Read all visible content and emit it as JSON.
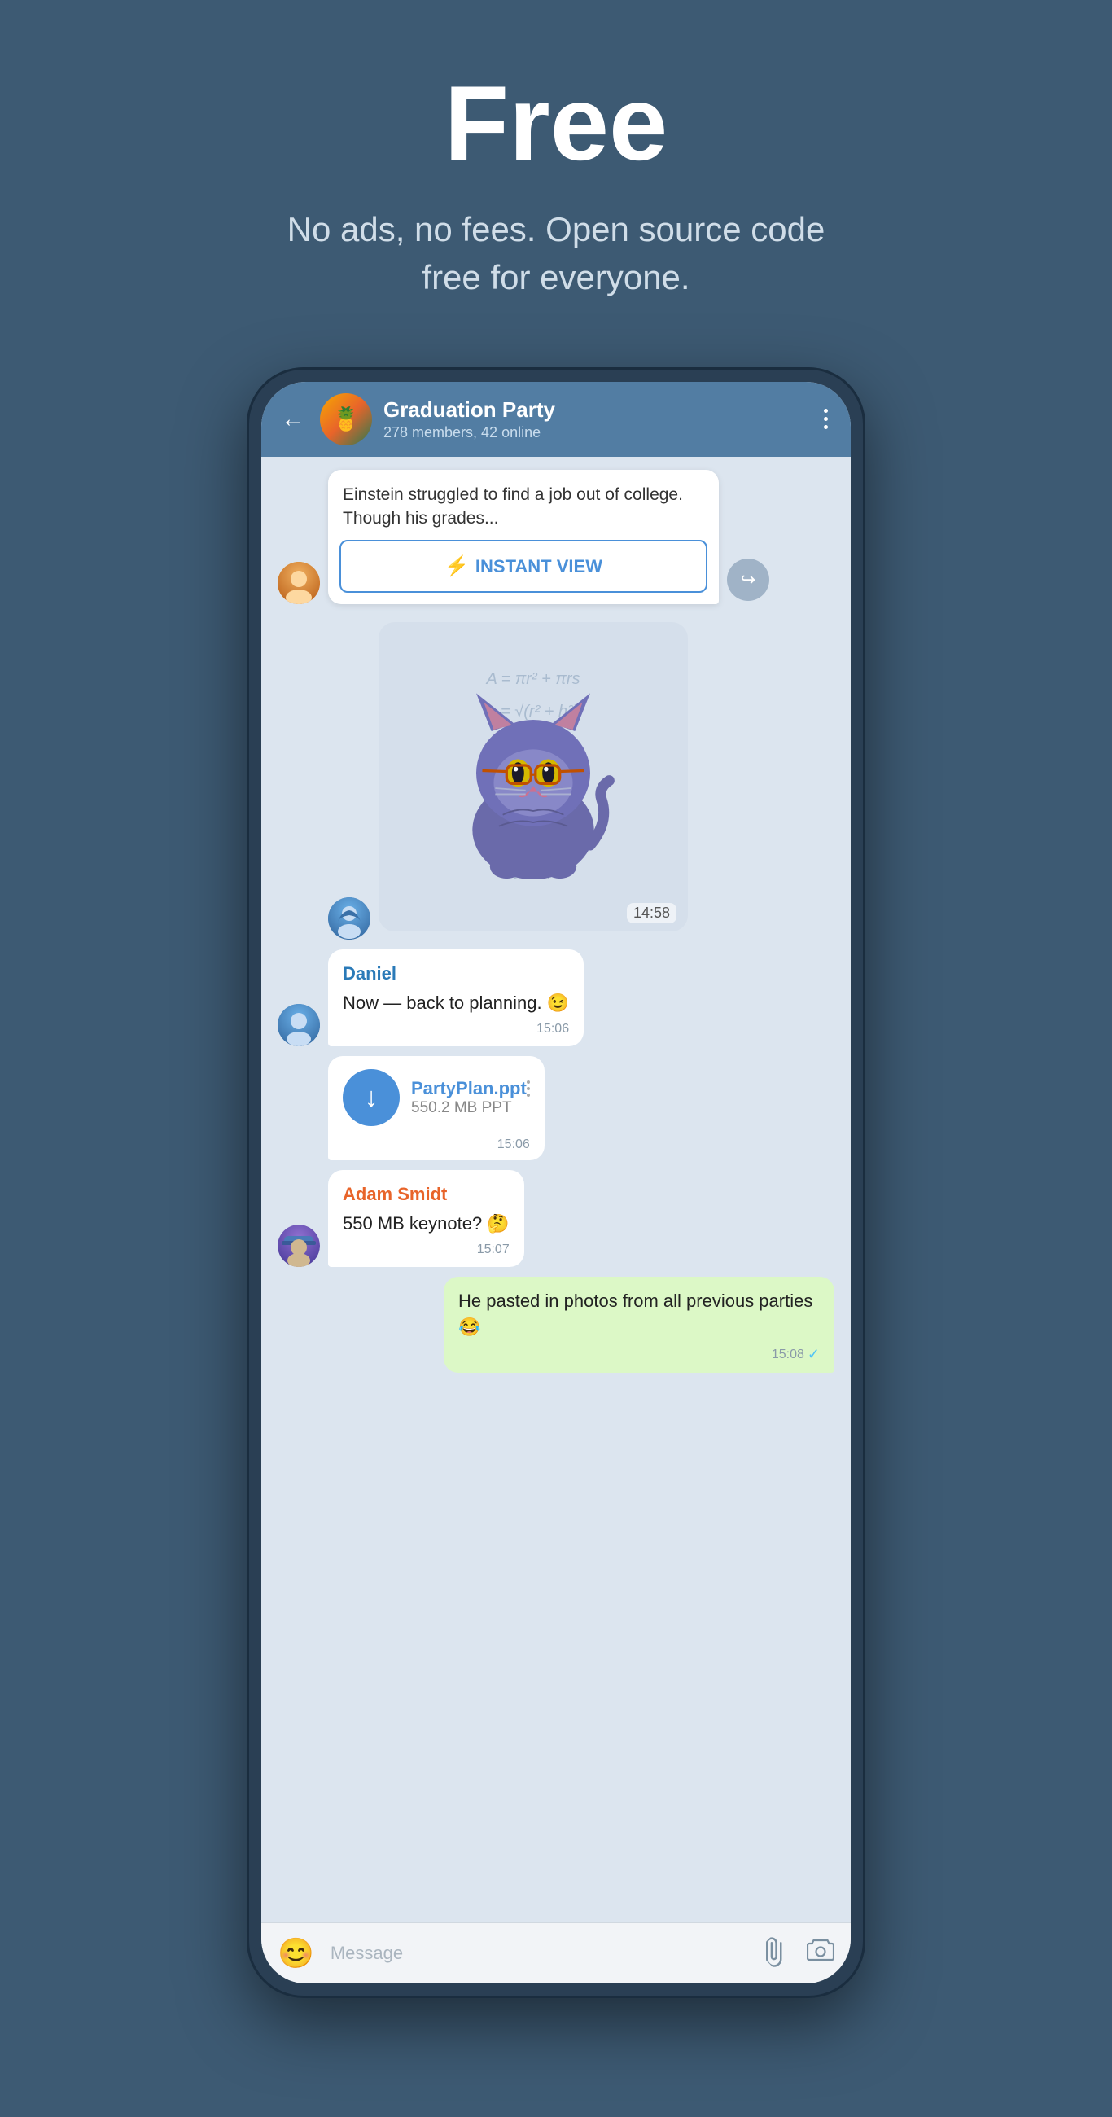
{
  "hero": {
    "title": "Free",
    "subtitle": "No ads, no fees. Open source code free for everyone."
  },
  "phone": {
    "header": {
      "back_label": "←",
      "group_name": "Graduation Party",
      "group_meta": "278 members, 42 online",
      "more_label": "⋮",
      "avatar_emoji": "🍍"
    },
    "messages": [
      {
        "id": "msg1",
        "type": "article",
        "article_text": "Einstein struggled to find a job out of college. Though his grades...",
        "instant_view_label": "INSTANT VIEW",
        "time": ""
      },
      {
        "id": "msg2",
        "type": "sticker",
        "time": "14:58"
      },
      {
        "id": "msg3",
        "type": "text",
        "sender": "Daniel",
        "sender_color": "blue",
        "text": "Now — back to planning. 😉",
        "time": "15:06"
      },
      {
        "id": "msg4",
        "type": "file",
        "file_name": "PartyPlan.ppt",
        "file_size": "550.2 MB PPT",
        "time": "15:06"
      },
      {
        "id": "msg5",
        "type": "text",
        "sender": "Adam Smidt",
        "sender_color": "orange",
        "text": "550 MB keynote? 🤔",
        "time": "15:07"
      },
      {
        "id": "msg6",
        "type": "own",
        "text": "He pasted in photos from all previous parties 😂",
        "time": "15:08",
        "checkmark": "✓"
      }
    ],
    "input": {
      "placeholder": "Message",
      "emoji_label": "😊",
      "attach_label": "📎",
      "camera_label": "📷"
    }
  }
}
